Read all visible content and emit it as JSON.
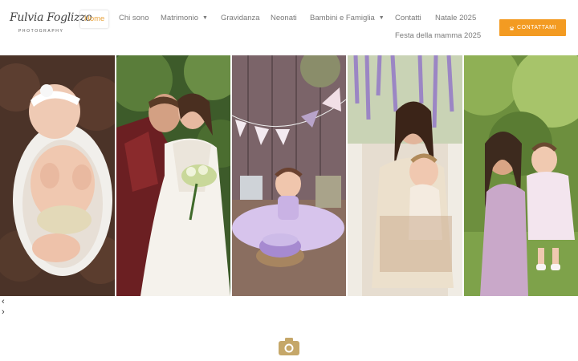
{
  "logo": {
    "name": "Fulvia Foglizzo",
    "tagline": "PHOTOGRAPHY"
  },
  "nav": {
    "items": [
      {
        "label": "Home",
        "active": true
      },
      {
        "label": "Chi sono"
      },
      {
        "label": "Matrimonio",
        "has_dropdown": true
      },
      {
        "label": "Gravidanza"
      },
      {
        "label": "Neonati"
      },
      {
        "label": "Bambini e Famiglia",
        "has_dropdown": true
      },
      {
        "label": "Contatti"
      },
      {
        "label": "Natale 2025"
      },
      {
        "label": "Festa della mamma 2025"
      }
    ]
  },
  "cta": {
    "label": "CONTATTAMI",
    "icon": "phone-icon"
  },
  "gallery": {
    "photos": [
      {
        "subject": "newborn baby sleeping"
      },
      {
        "subject": "bride and groom"
      },
      {
        "subject": "one-year cake smash"
      },
      {
        "subject": "mother and daughter with wisteria"
      },
      {
        "subject": "mother holding daughter outdoors"
      }
    ],
    "prev_icon": "chevron-left-icon",
    "next_icon": "chevron-right-icon"
  },
  "colors": {
    "accent": "#f39b22",
    "nav_active": "#e8a33d",
    "nav_text": "#7a7a7a"
  },
  "footer_icon": "camera-icon"
}
